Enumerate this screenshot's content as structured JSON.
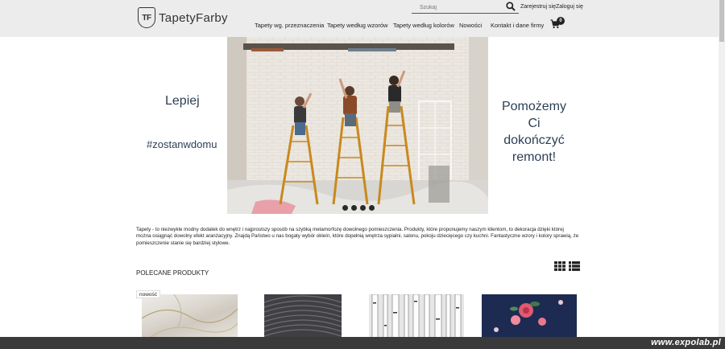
{
  "header": {
    "logo_mark": "TF",
    "logo_text": "TapetyFarby",
    "search_placeholder": "Szukaj",
    "register": "Zarejestruj się",
    "login": "Zaloguj się",
    "nav": [
      "Tapety wg. przeznaczenia",
      "Tapety według wzorów",
      "Tapety według kolorów",
      "Nowości",
      "Kontakt i dane firmy"
    ],
    "cart_count": "0"
  },
  "hero": {
    "left_line1": "Lepiej",
    "left_line2": "#zostanwdomu",
    "right_text": [
      "Pomożemy",
      "Ci",
      "dokończyć",
      "remont!"
    ],
    "slides_count": 4,
    "active_slide": 1
  },
  "description": "Tapety - to niezwykle modny dodatek do wnętrz i najprostszy sposób na szybką metamorfozę dowolnego pomieszczenia. Produkty, które proponujemy naszym klientom, to dekoracja dzięki której można osiągnąć dowolny efekt aranżacyjny. Znajdą Państwo u nas bogaty wybór okleín, które dopełnią wnętrza sypialni, salonu, pokoju dziecięcego czy kuchni. Fantastyczne wzory i kolory sprawią, że pomieszczenie stanie się bardziej stylowe.",
  "featured": {
    "title": "POLECANE PRODUKTY",
    "badge": "nowość"
  },
  "watermark": "www.expolab.pl",
  "icons": {
    "search": "search-icon",
    "cart": "cart-icon",
    "grid": "grid-view-icon",
    "list": "list-view-icon"
  }
}
